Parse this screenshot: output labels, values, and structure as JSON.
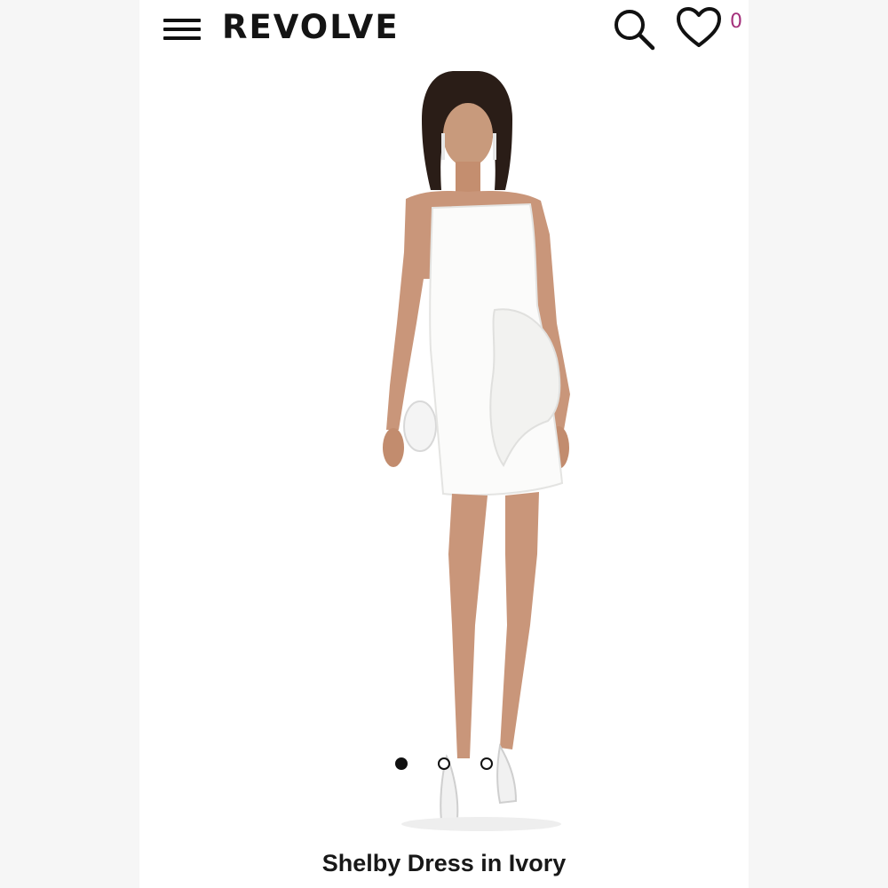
{
  "header": {
    "logo": "REVOLVE",
    "wishlist_count": "0",
    "icons": {
      "menu": "hamburger-menu-icon",
      "search": "search-icon",
      "wishlist": "heart-icon"
    }
  },
  "product": {
    "title": "Shelby Dress in Ivory",
    "image_alt": "model-wearing-ivory-dress",
    "carousel": {
      "total": 3,
      "active_index": 0
    }
  },
  "colors": {
    "accent": "#a4307b",
    "text": "#111111",
    "background": "#ffffff"
  }
}
